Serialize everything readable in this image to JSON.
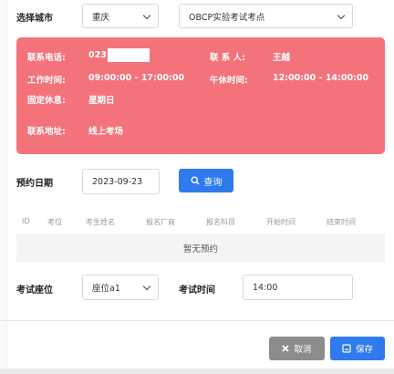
{
  "city": {
    "label": "选择城市",
    "selected_city": "重庆",
    "selected_site": "OBCP实验考试考点"
  },
  "info": {
    "phone_label": "联系电话:",
    "phone_value": "023",
    "contact_label": "联 系 人:",
    "contact_value": "王越",
    "work_time_label": "工作时间:",
    "work_time_value": "09:00:00 - 17:00:00",
    "lunch_label": "午休时间:",
    "lunch_value": "12:00:00 - 14:00:00",
    "rest_label": "固定休息:",
    "rest_value": "星期日",
    "address_label": "联系地址:",
    "address_value": "线上考场",
    "card_color": "#f4727a"
  },
  "booking": {
    "date_label": "预约日期",
    "date_value": "2023-09-23",
    "query_label": "查询",
    "accent": "#2f7bed"
  },
  "table": {
    "columns": [
      "ID",
      "考位",
      "考生姓名",
      "报名厂商",
      "报名科目",
      "开始时间",
      "结束时间"
    ],
    "empty_text": "暂无预约"
  },
  "exam": {
    "seat_label": "考试座位",
    "seat_value": "座位a1",
    "time_label": "考试时间",
    "time_value": "14:00"
  },
  "footer": {
    "cancel_label": "取消",
    "save_label": "保存",
    "cancel_color": "#8c8c8c"
  },
  "icons": {
    "query": "search-icon",
    "cancel": "close-icon",
    "save": "save-icon"
  }
}
